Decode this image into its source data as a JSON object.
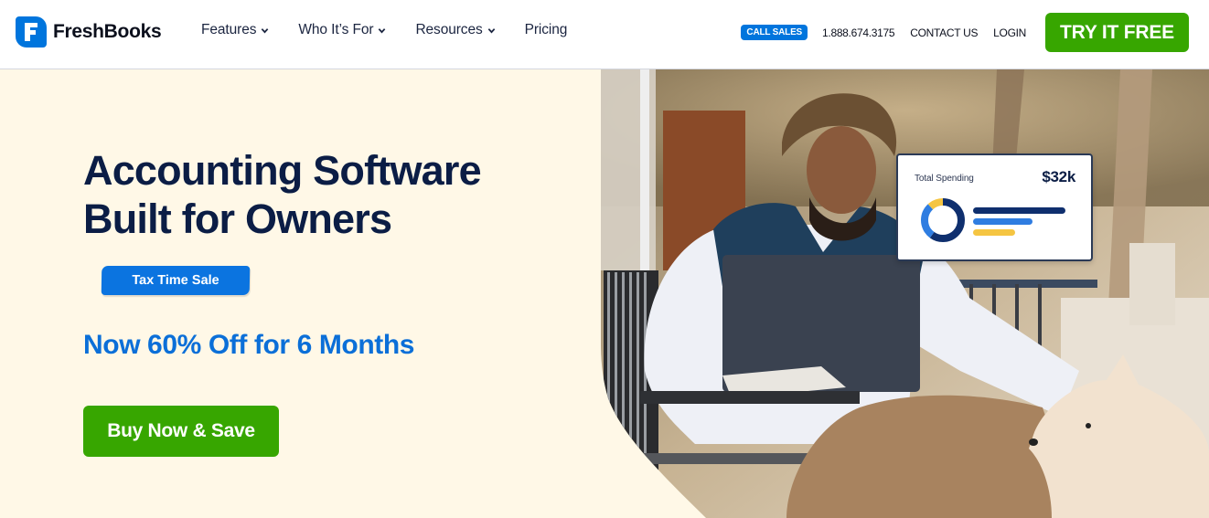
{
  "header": {
    "brand": "FreshBooks",
    "nav": [
      {
        "label": "Features",
        "has_dropdown": true
      },
      {
        "label": "Who It’s For",
        "has_dropdown": true
      },
      {
        "label": "Resources",
        "has_dropdown": true
      },
      {
        "label": "Pricing",
        "has_dropdown": false
      }
    ],
    "call_sales_badge": "CALL SALES",
    "phone": "1.888.674.3175",
    "contact_label": "CONTACT US",
    "login_label": "LOGIN",
    "cta_label": "TRY IT FREE"
  },
  "hero": {
    "title_line1": "Accounting Software",
    "title_line2": "Built for Owners",
    "sale_badge": "Tax Time Sale",
    "offer": "Now 60% Off for 6 Months",
    "cta_label": "Buy Now & Save",
    "photo_alt": "Man working on laptop at outdoor cafe table with a white dog"
  },
  "spending_card": {
    "label": "Total Spending",
    "value": "$32k",
    "donut_segments": [
      {
        "name": "navy",
        "fraction": 0.6,
        "color": "#0f2f6e"
      },
      {
        "name": "blue",
        "fraction": 0.28,
        "color": "#2f7de1"
      },
      {
        "name": "yellow",
        "fraction": 0.12,
        "color": "#f5c542"
      }
    ],
    "bars": [
      {
        "name": "navy",
        "fraction": 1.0,
        "color": "#0f2f6e"
      },
      {
        "name": "blue",
        "fraction": 0.64,
        "color": "#2f7de1"
      },
      {
        "name": "yellow",
        "fraction": 0.46,
        "color": "#f5c542"
      }
    ]
  },
  "colors": {
    "brand_blue": "#0075dd",
    "cta_green": "#37a600",
    "hero_bg": "#fff8e7",
    "title_navy": "#0b1d45",
    "offer_blue": "#0b6fd8"
  }
}
